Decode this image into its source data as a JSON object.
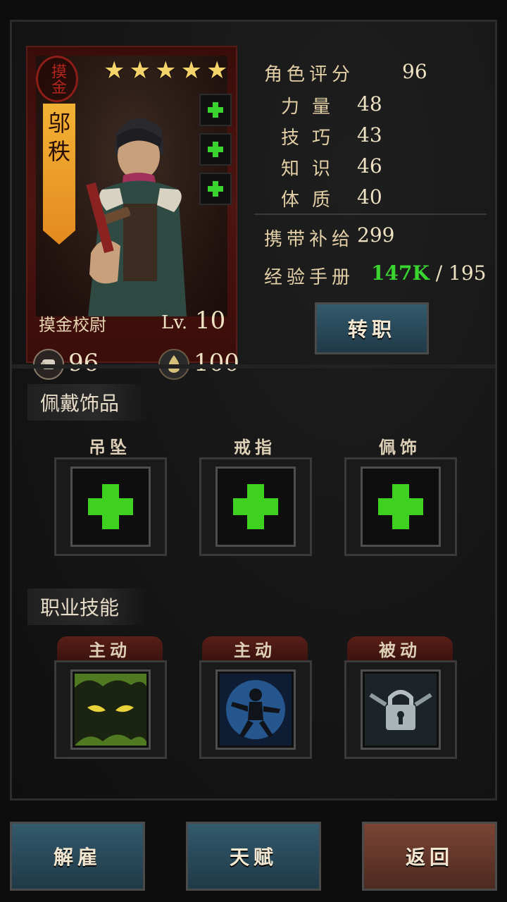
{
  "character": {
    "seal_text": "摸金",
    "name_chars": [
      "邬",
      "秩"
    ],
    "stars": 5,
    "class_name": "摸金校尉",
    "level_prefix": "Lv.",
    "level": "10",
    "strength_value": "96",
    "spirit_value": "100",
    "quick_slots": [
      "plus-icon",
      "plus-icon",
      "plus-icon"
    ]
  },
  "stats": {
    "rating_label": "角色评分",
    "rating_value": "96",
    "attributes": [
      {
        "label": "力量",
        "value": "48"
      },
      {
        "label": "技巧",
        "value": "43"
      },
      {
        "label": "知识",
        "value": "46"
      },
      {
        "label": "体质",
        "value": "40"
      }
    ],
    "supplies_label": "携带补给",
    "supplies_value": "299",
    "exp_label": "经验手册",
    "exp_current": "147K",
    "exp_sep": " / ",
    "exp_needed": "195",
    "exp_current_color": "#39d42f"
  },
  "buttons": {
    "change_class": "转职",
    "dismiss": "解雇",
    "talent": "天赋",
    "back": "返回"
  },
  "accessories": {
    "title": "佩戴饰品",
    "slots": [
      {
        "label": "吊坠",
        "icon": "add-icon"
      },
      {
        "label": "戒指",
        "icon": "add-icon"
      },
      {
        "label": "佩饰",
        "icon": "add-icon"
      }
    ]
  },
  "skills": {
    "title": "职业技能",
    "slots": [
      {
        "label": "主动",
        "icon": "forest-eyes-icon"
      },
      {
        "label": "主动",
        "icon": "martial-stance-icon"
      },
      {
        "label": "被动",
        "icon": "padlock-chain-icon"
      }
    ]
  },
  "colors": {
    "accent_green": "#39d42f",
    "button_blue": "#2d5164",
    "button_red": "#6a3a2c",
    "banner_orange": "#e9a02a"
  }
}
